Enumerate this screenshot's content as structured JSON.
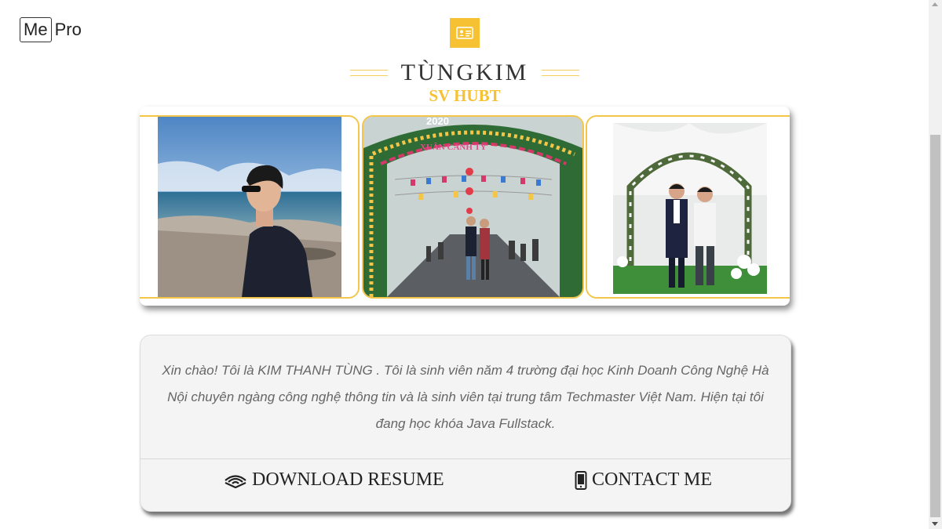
{
  "logo": {
    "boxed": "Me",
    "text": "Pro"
  },
  "header": {
    "badge_icon": "id-card-icon",
    "name": "TÙNGKIM",
    "subtitle": "SV HUBT",
    "accent_color": "#f6c133"
  },
  "gallery": {
    "photos": [
      {
        "icon": "beach-portrait-photo"
      },
      {
        "icon": "flower-arch-couple-photo"
      },
      {
        "icon": "wedding-arch-friends-photo"
      }
    ],
    "arch_sign": "2020",
    "arch_caption": "XUÂN CANH TÝ",
    "frame_color": "#f3c548"
  },
  "about": {
    "text": "Xin chào! Tôi là KIM THANH TÙNG . Tôi là sinh viên năm 4 trường đại học Kinh Doanh Công Nghệ Hà Nội chuyên ngàng công nghệ thông tin và là sinh viên tại trung tâm Techmaster Việt Nam. Hiện tại tôi đang học khóa Java Fullstack.",
    "download_label": "DOWNLOAD RESUME",
    "download_icon": "audible-waves-icon",
    "contact_label": "CONTACT ME",
    "contact_icon": "mobile-phone-icon"
  }
}
